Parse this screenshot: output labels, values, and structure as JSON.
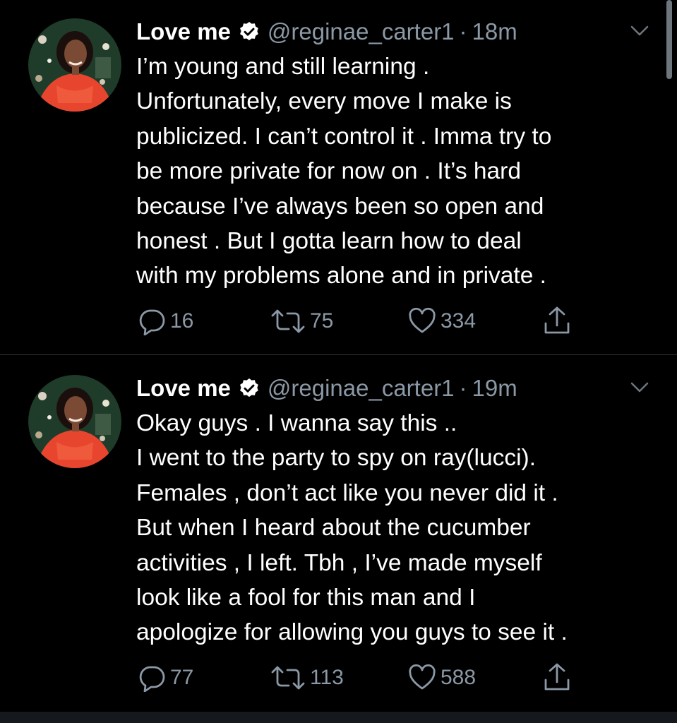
{
  "tweets": [
    {
      "name": "Love me",
      "handle": "@reginae_carter1",
      "separator": "·",
      "time": "18m",
      "text": "I’m young and still learning .\nUnfortunately, every move I make is\npublicized. I can’t control it . Imma try to\nbe more private for now on . It’s hard\nbecause I’ve always been so open and\nhonest . But I gotta learn how to deal\nwith my problems alone and in private .",
      "replies": "16",
      "retweets": "75",
      "likes": "334"
    },
    {
      "name": "Love me",
      "handle": "@reginae_carter1",
      "separator": "·",
      "time": "19m",
      "text": "Okay guys . I wanna say this ..\nI went to the party to spy on ray(lucci).\nFemales , don’t act like you never did it .\nBut when I heard about the cucumber\nactivities , I left. Tbh , I’ve made myself\nlook like a fool for this man and I\napologize for allowing you guys to see it .",
      "replies": "77",
      "retweets": "113",
      "likes": "588"
    }
  ],
  "icons": {
    "verified": "verified-badge-icon",
    "caret": "chevron-down-icon",
    "reply": "reply-icon",
    "retweet": "retweet-icon",
    "like": "heart-icon",
    "share": "share-icon"
  },
  "colors": {
    "background": "#000000",
    "text": "#ffffff",
    "secondary": "#8b98a5",
    "divider": "#2f3336"
  }
}
